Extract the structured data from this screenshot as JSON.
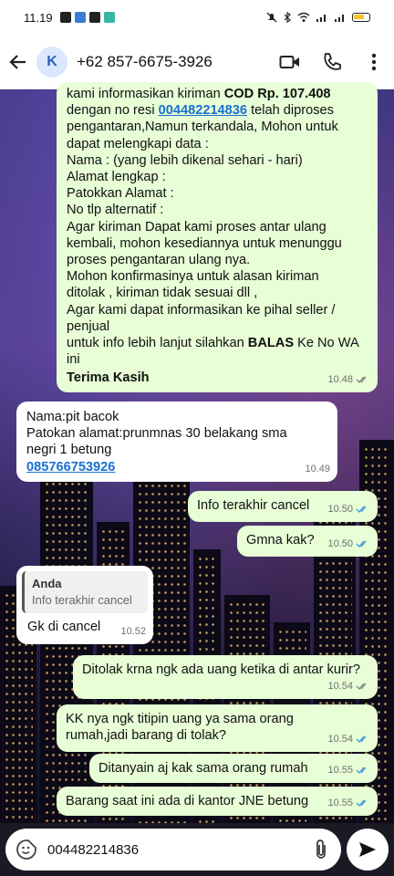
{
  "status_bar": {
    "time": "11.19"
  },
  "header": {
    "avatar_letter": "K",
    "contact": "+62 857-6675-3926"
  },
  "messages": [
    {
      "lines": [
        {
          "pre": "kami informasikan kiriman ",
          "bold": "COD  Rp. 107.408"
        },
        {
          "pre": "dengan no resi ",
          "link": "004482214836",
          "post": " telah diproses"
        },
        {
          "text": "pengantaran,Namun terkandala, Mohon untuk"
        },
        {
          "text": "dapat melengkapi data :"
        },
        {
          "text": "Nama : (yang lebih dikenal sehari - hari)"
        },
        {
          "text": "Alamat  lengkap :"
        },
        {
          "text": "Patokkan Alamat :"
        },
        {
          "text": "No tlp alternatif :"
        },
        {
          "text": "Agar kiriman Dapat kami proses antar ulang"
        },
        {
          "text": "kembali, mohon kesediannya untuk menunggu"
        },
        {
          "text": "proses pengantaran ulang nya."
        },
        {
          "text": "Mohon konfirmasinya untuk alasan kiriman"
        },
        {
          "text": "ditolak , kiriman tidak sesuai dll ,"
        },
        {
          "text": "Agar kami dapat informasikan ke pihal seller /"
        },
        {
          "text": "penjual"
        },
        {
          "pre": "untuk info lebih lanjut silahkan ",
          "bold": "BALAS",
          "post": " Ke No WA"
        },
        {
          "text": "ini"
        },
        {
          "bold": "Terima Kasih"
        }
      ],
      "time": "10.48"
    },
    {
      "lines": [
        "Nama:pit bacok",
        "Patokan alamat:prunmnas 30 belakang sma",
        "negri 1 betung"
      ],
      "link": "085766753926",
      "time": "10.49"
    },
    {
      "text": "Info terakhir cancel",
      "time": "10.50"
    },
    {
      "text": "Gmna kak?",
      "time": "10.50"
    },
    {
      "quote_author": "Anda",
      "quote_text": "Info terakhir cancel",
      "text": "Gk di cancel",
      "time": "10.52"
    },
    {
      "text": "Ditolak krna ngk ada uang ketika di antar kurir?",
      "time": "10.54"
    },
    {
      "lines": [
        "KK nya ngk titipin uang ya sama orang",
        "rumah,jadi barang di tolak?"
      ],
      "time": "10.54"
    },
    {
      "text": "Ditanyain aj kak sama orang rumah",
      "time": "10.55"
    },
    {
      "text": "Barang saat ini ada di kantor JNE betung",
      "time": "10.55"
    }
  ],
  "composer": {
    "value": "004482214836"
  },
  "colors": {
    "outgoing": "#e7fed6",
    "incoming": "#ffffff",
    "ticks": "#4a9ee0",
    "link": "#1a6fd0"
  }
}
